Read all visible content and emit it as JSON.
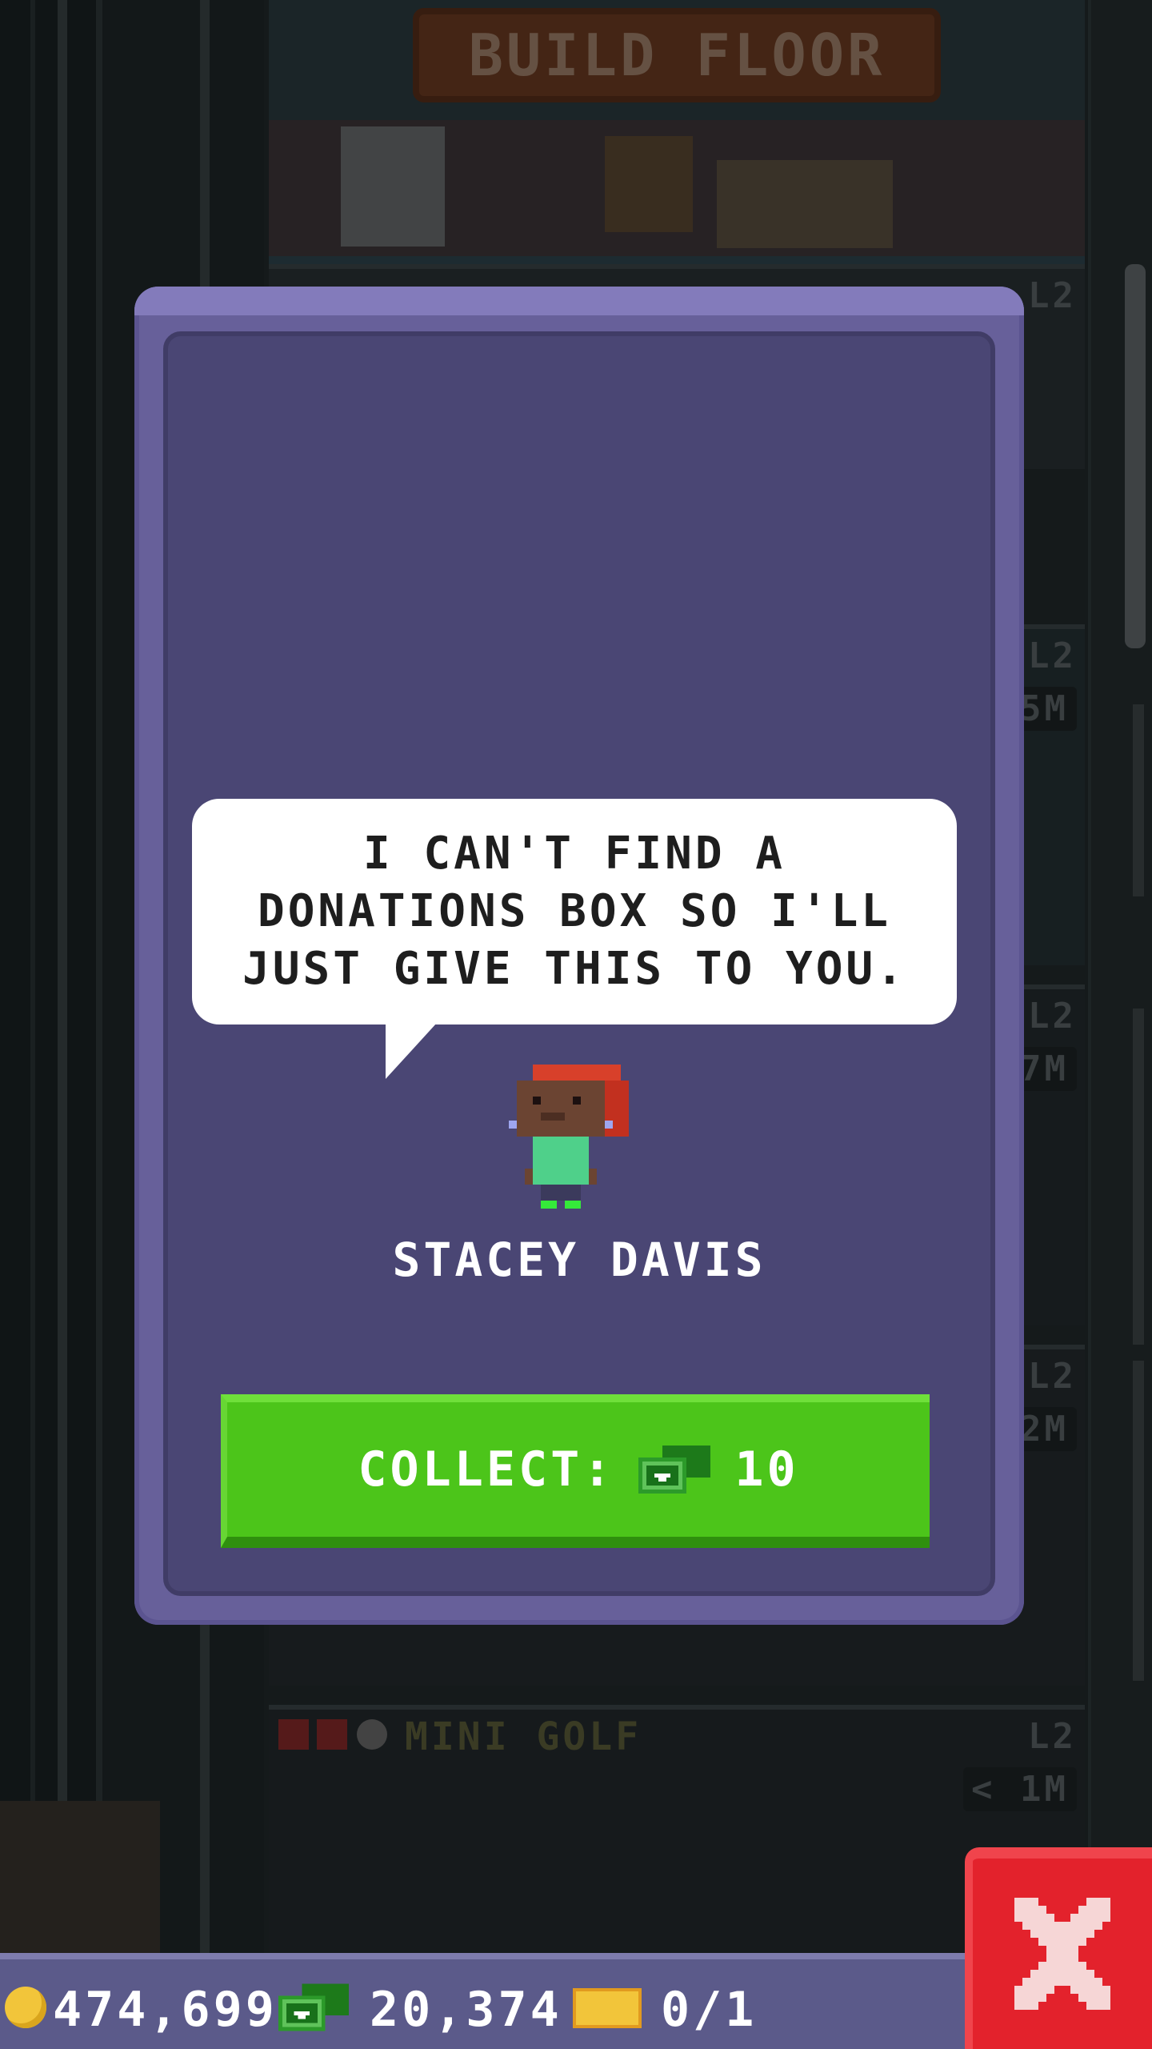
{
  "banner": {
    "build_floor_label": "BUILD FLOOR"
  },
  "floors": [
    {
      "level": "L2"
    },
    {
      "level": "L2",
      "time": "5M"
    },
    {
      "level": "L2",
      "time": "7M"
    },
    {
      "level": "L2",
      "time": "2M"
    },
    {
      "name": "MINI GOLF",
      "level": "L2",
      "time": "< 1M"
    }
  ],
  "dialog": {
    "speech": "I CAN'T FIND A DONATIONS BOX SO I'LL JUST GIVE THIS TO YOU.",
    "character_name": "STACEY DAVIS",
    "collect_label": "COLLECT:",
    "collect_amount": "10",
    "collect_currency_icon": "tower-bux-icon"
  },
  "status_bar": {
    "coins": "474,699",
    "bux": "20,374",
    "tickets": "0/1"
  },
  "colors": {
    "modal": "#67609a",
    "modal_inner": "#4a4674",
    "collect_button": "#4cc51a",
    "close_button": "#e3222c",
    "bottom_bar": "#5b5a8a"
  }
}
